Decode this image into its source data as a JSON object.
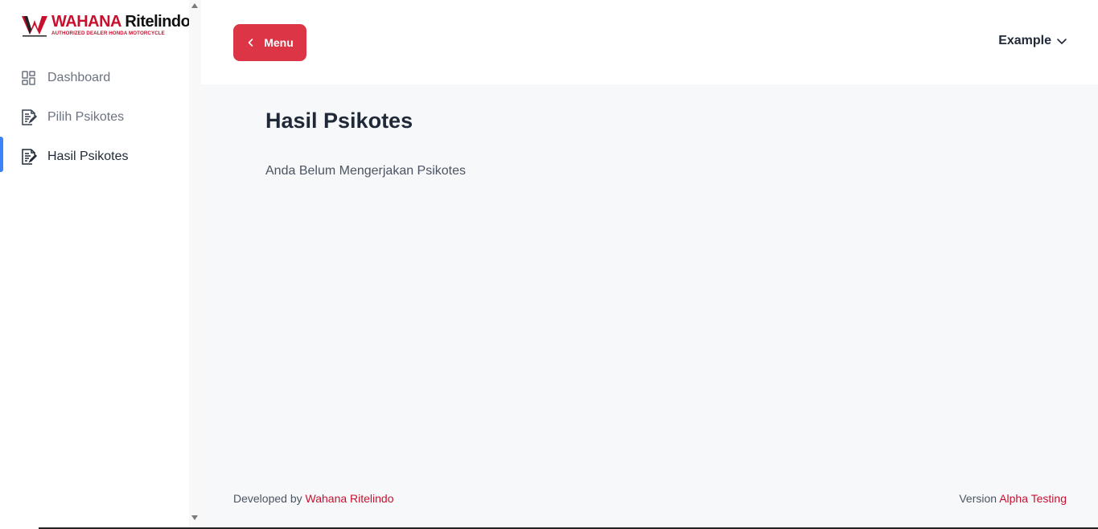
{
  "brand": {
    "name_part1": "WAHANA",
    "name_part2": "Ritelindo",
    "tagline": "AUTHORIZED DEALER HONDA MOTORCYCLE",
    "accent_color": "#c8102e"
  },
  "sidebar": {
    "items": [
      {
        "label": "Dashboard",
        "icon": "dashboard-grid-icon",
        "active": false
      },
      {
        "label": "Pilih Psikotes",
        "icon": "document-edit-icon",
        "active": false
      },
      {
        "label": "Hasil Psikotes",
        "icon": "document-edit-icon",
        "active": true
      }
    ],
    "active_indicator_color": "#3b82f6"
  },
  "header": {
    "menu_button_label": "Menu",
    "menu_button_color": "#dc3545",
    "user_name": "Example"
  },
  "main": {
    "title": "Hasil Psikotes",
    "empty_message": "Anda Belum Mengerjakan Psikotes"
  },
  "footer": {
    "developed_by_prefix": "Developed by",
    "developed_by_link": "Wahana Ritelindo",
    "version_prefix": "Version",
    "version_link": "Alpha Testing"
  }
}
